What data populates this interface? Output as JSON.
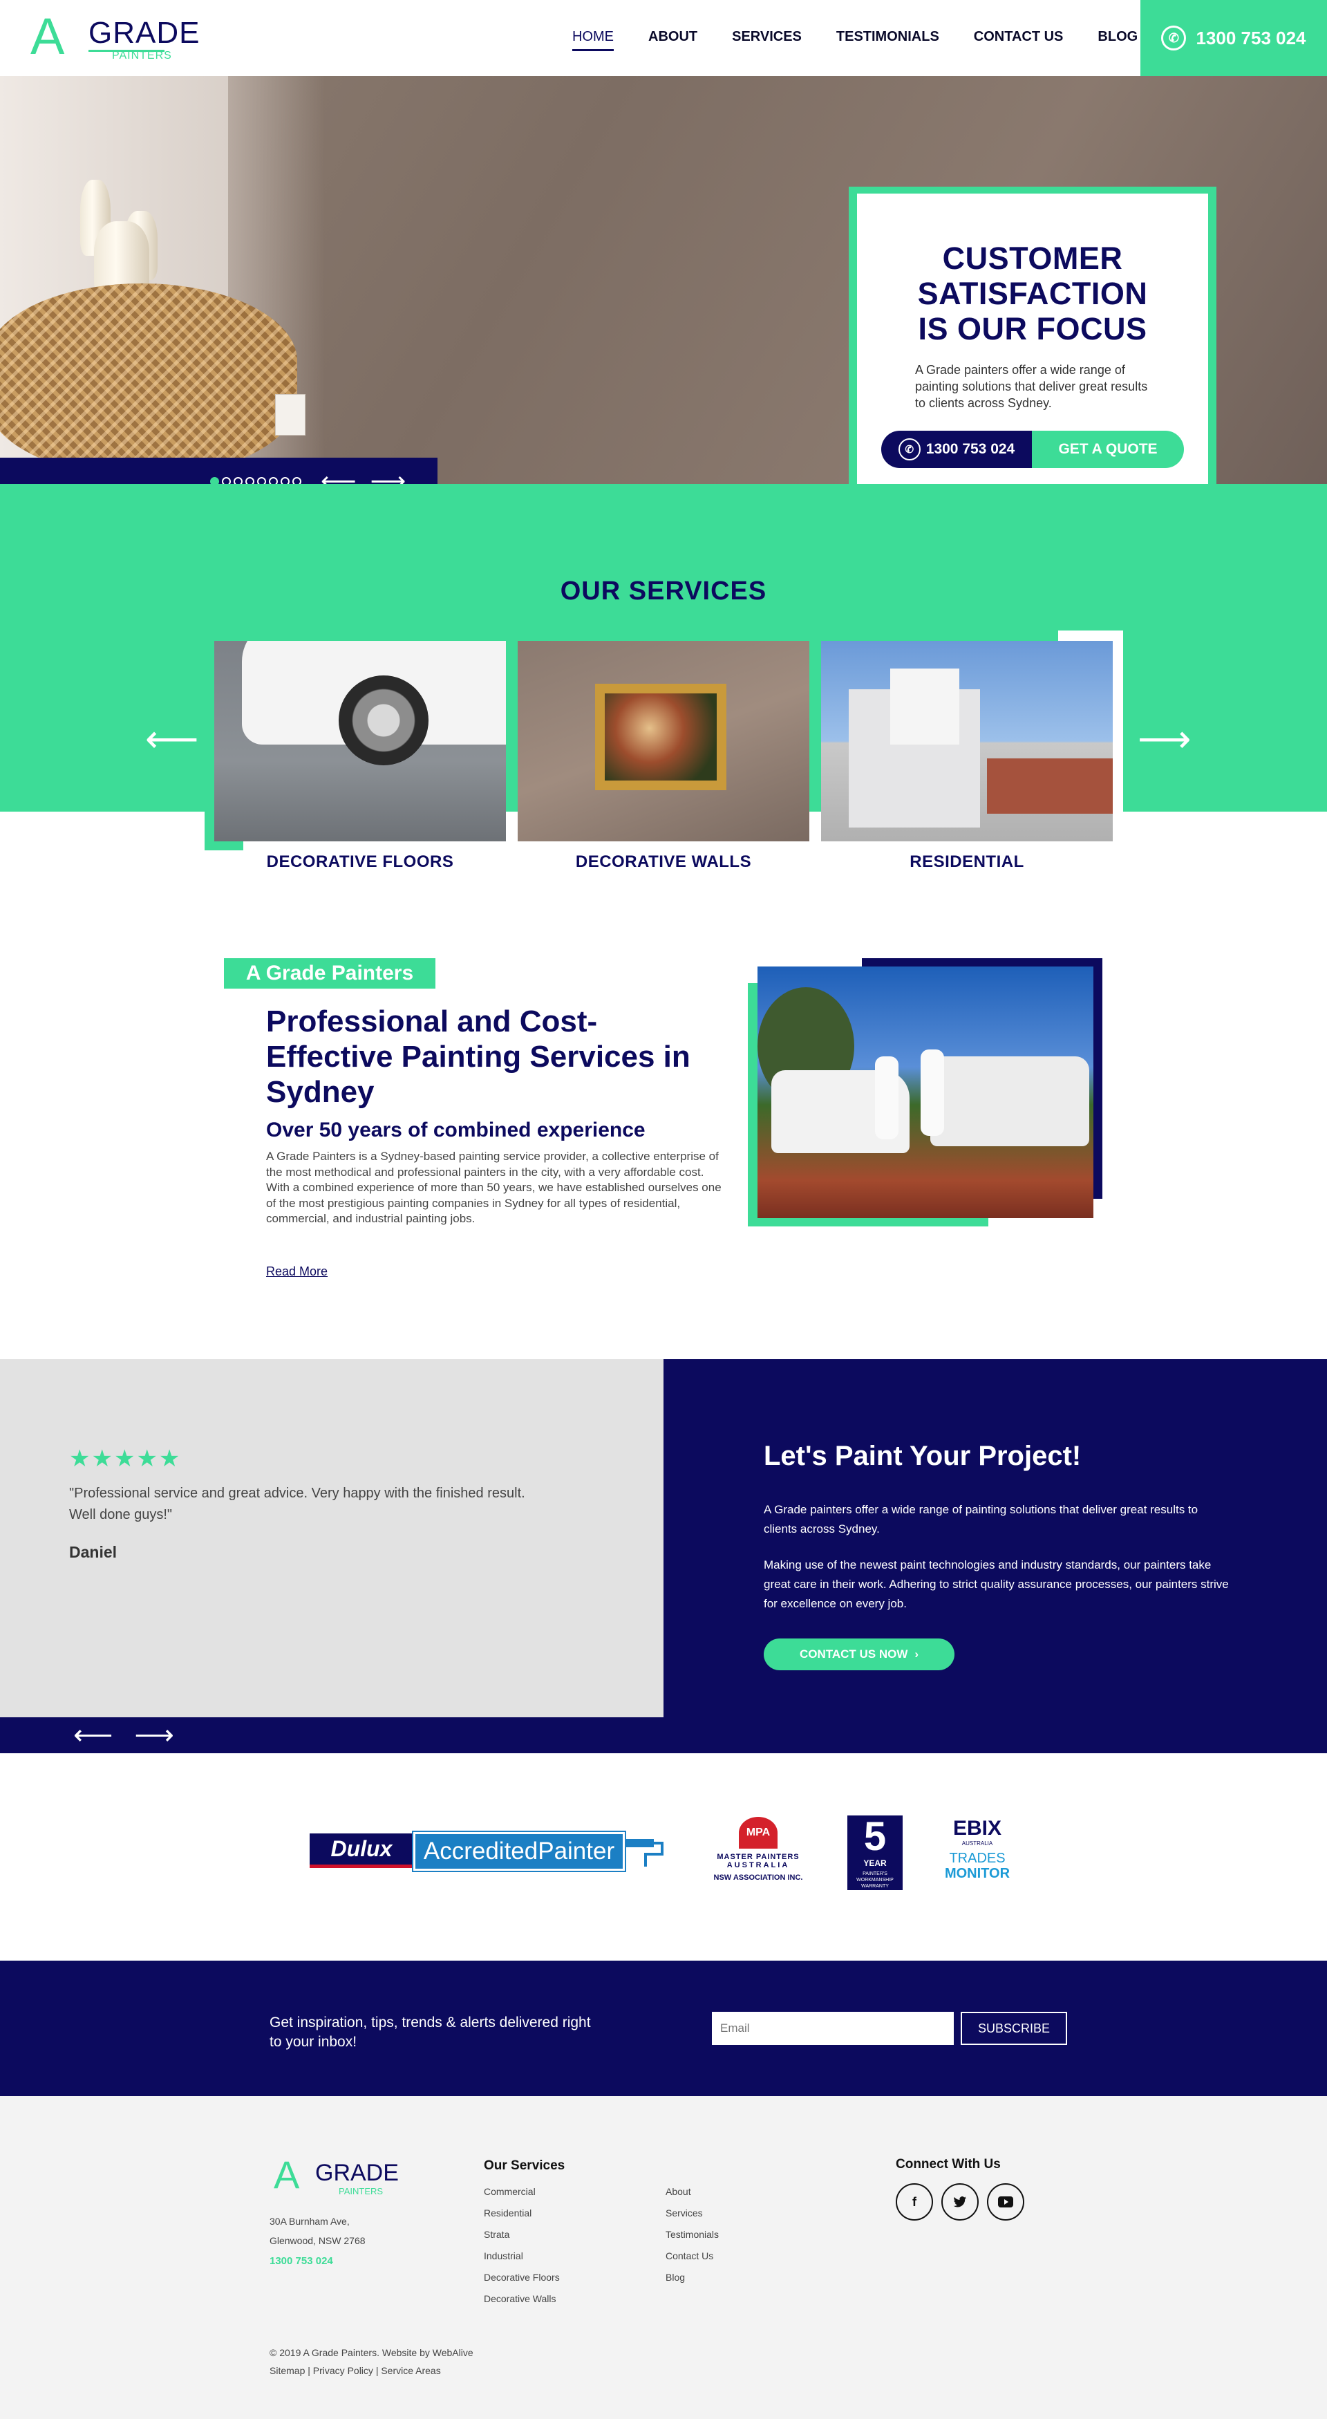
{
  "header": {
    "logo": {
      "a": "A",
      "grade": "GRADE",
      "painters": "PAINTERS"
    },
    "nav": [
      "HOME",
      "ABOUT",
      "SERVICES",
      "TESTIMONIALS",
      "CONTACT US",
      "BLOG"
    ],
    "active_nav": "HOME",
    "phone": "1300 753 024"
  },
  "hero": {
    "title": "CUSTOMER SATISFACTION IS OUR FOCUS",
    "text": "A Grade painters offer a wide range of painting solutions that deliver great results to clients across Sydney.",
    "phone_label": "1300 753 024",
    "quote_label": "GET A QUOTE",
    "slides_total": 8,
    "slide_active": 1
  },
  "services": {
    "title": "OUR SERVICES",
    "items": [
      {
        "label": "DECORATIVE FLOORS"
      },
      {
        "label": "DECORATIVE WALLS"
      },
      {
        "label": "RESIDENTIAL"
      }
    ]
  },
  "about": {
    "tag": "A Grade Painters",
    "heading": "Professional and Cost-Effective Painting Services in Sydney",
    "subheading": "Over 50 years of combined experience",
    "body": "A Grade Painters is a Sydney-based painting service provider, a collective enterprise of the most methodical and professional painters in the city, with a very affordable cost. With a combined experience of more than 50 years, we have established ourselves one of the most prestigious painting companies in Sydney for all types of residential, commercial, and industrial painting jobs.",
    "read_more": "Read More"
  },
  "testimonial": {
    "stars": 5,
    "quote": "\"Professional service and great advice. Very happy with the finished result. Well done guys!\"",
    "author": "Daniel"
  },
  "project": {
    "title": "Let's Paint Your Project!",
    "p1": "A Grade painters offer a wide range of painting solutions that deliver great results to clients across Sydney.",
    "p2": "Making use of the newest paint technologies and industry standards, our painters take great care in their work. Adhering to strict quality assurance processes, our painters strive for excellence on every job.",
    "button": "CONTACT US NOW"
  },
  "partners": {
    "dulux": "Dulux",
    "accredited": "AccreditedPainter",
    "mpa_top": "MPA",
    "mpa_line1": "MASTER PAINTERS",
    "mpa_line2": "AUSTRALIA",
    "mpa_line3": "NSW ASSOCIATION INC.",
    "five_num": "5",
    "five_year": "YEAR",
    "five_sub": "PAINTER'S WORKMANSHIP WARRANTY",
    "ebix": "EBIX",
    "ebix_sub": "AUSTRALIA",
    "trades": "TRADES",
    "monitor": "MONITOR"
  },
  "newsletter": {
    "text": "Get inspiration, tips, trends & alerts delivered right to your inbox!",
    "placeholder": "Email",
    "button": "SUBSCRIBE"
  },
  "footer": {
    "address1": "30A Burnham Ave,",
    "address2": "Glenwood, NSW 2768",
    "phone": "1300 753 024",
    "services_title": "Our Services",
    "services": [
      "Commercial",
      "Residential",
      "Strata",
      "Industrial",
      "Decorative Floors",
      "Decorative Walls"
    ],
    "links": [
      "About",
      "Services",
      "Testimonials",
      "Contact Us",
      "Blog"
    ],
    "connect_title": "Connect With Us",
    "social": [
      {
        "icon": "facebook-icon",
        "glyph": "f"
      },
      {
        "icon": "twitter-icon",
        "glyph": "🐦"
      },
      {
        "icon": "youtube-icon",
        "glyph": "▶"
      }
    ],
    "copyright": "© 2019 A Grade Painters. Website by WebAlive",
    "bottom_links": [
      "Sitemap",
      "Privacy Policy",
      "Service Areas"
    ]
  },
  "colors": {
    "green": "#3ddc97",
    "navy": "#0c0a5e"
  }
}
